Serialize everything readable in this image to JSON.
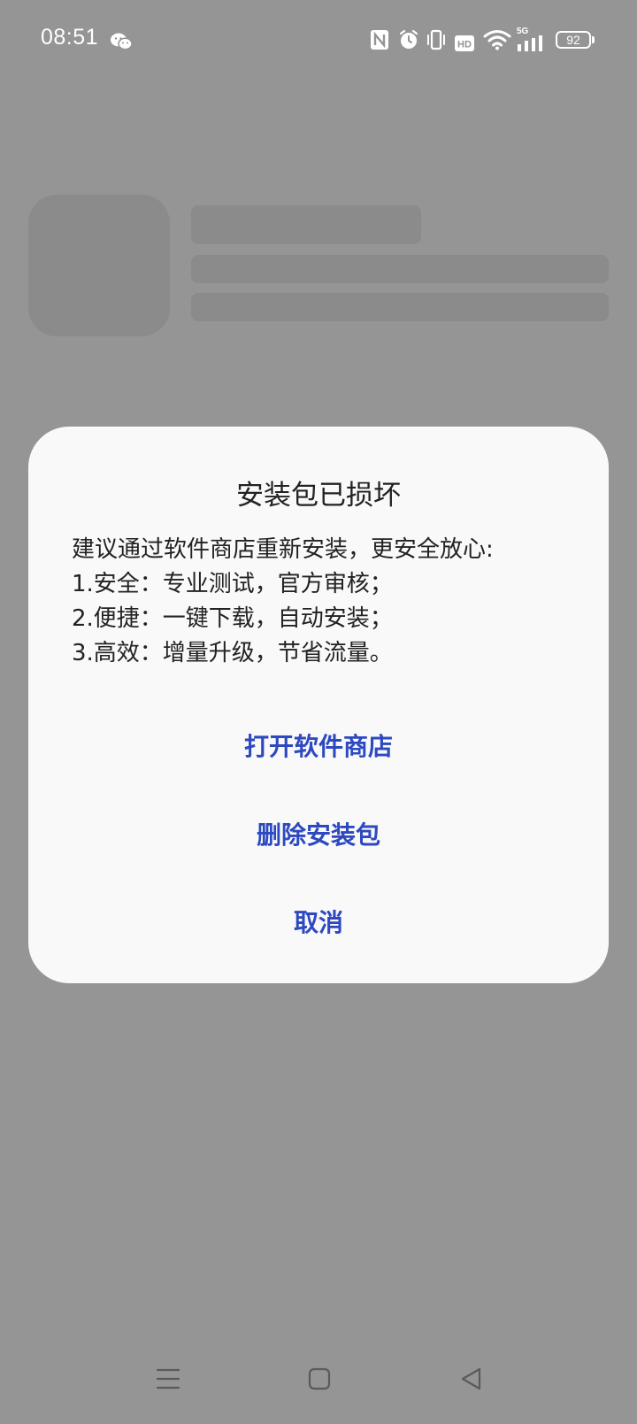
{
  "status_bar": {
    "time": "08:51",
    "battery": "92",
    "network": "5G",
    "icons": [
      "wechat-icon",
      "nfc-icon",
      "alarm-icon",
      "vibrate-icon",
      "hd-icon",
      "wifi-icon",
      "signal-icon",
      "battery-icon"
    ]
  },
  "dialog": {
    "title": "安装包已损坏",
    "body": [
      "建议通过软件商店重新安装，更安全放心:",
      "1.安全：专业测试，官方审核；",
      "2.便捷：一键下载，自动安装；",
      "3.高效：增量升级，节省流量。"
    ],
    "buttons": {
      "open_store": "打开软件商店",
      "delete_package": "删除安装包",
      "cancel": "取消"
    }
  },
  "colors": {
    "scrim": "#959595",
    "dialog_bg": "#f9f9f9",
    "accent": "#2d49c0",
    "text": "#222222"
  },
  "nav_bar": {
    "icons": [
      "menu-icon",
      "home-icon",
      "back-icon"
    ]
  }
}
